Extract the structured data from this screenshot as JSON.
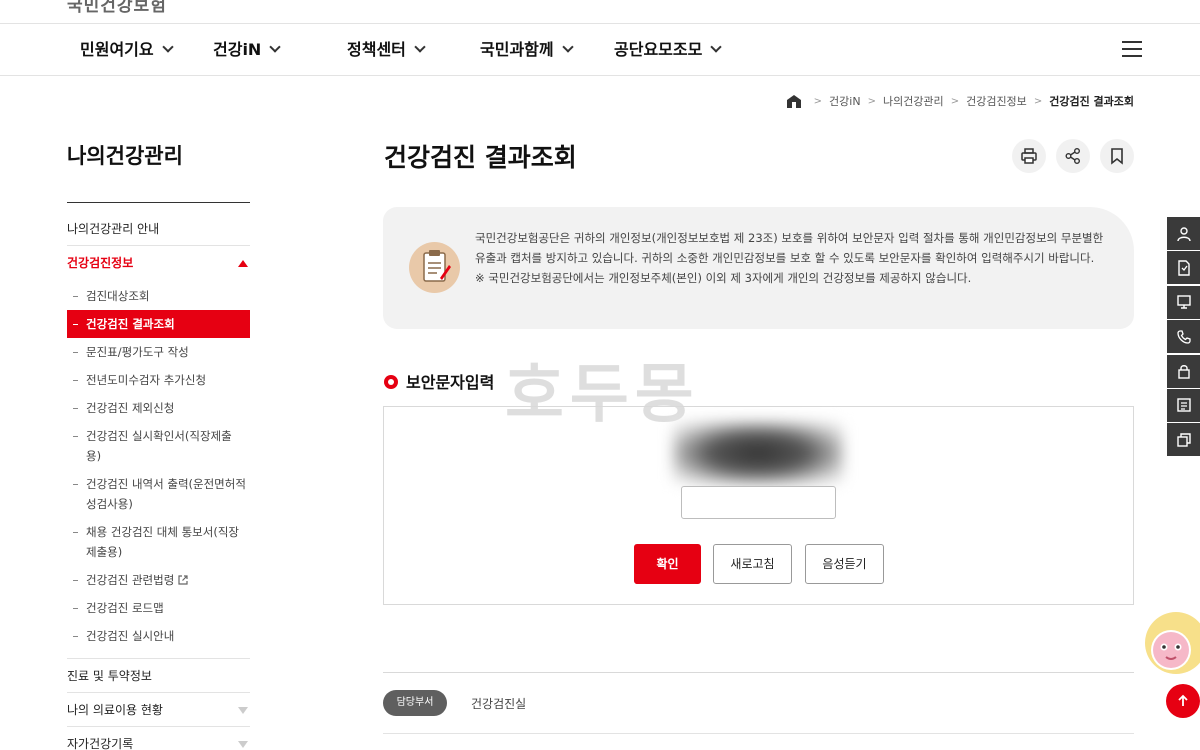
{
  "header": {
    "logo_text": "국민건강보험",
    "gnb": [
      {
        "label": "민원여기요"
      },
      {
        "label": "건강iN"
      },
      {
        "label": "정책센터"
      },
      {
        "label": "국민과함께"
      },
      {
        "label": "공단요모조모"
      }
    ]
  },
  "breadcrumb": {
    "items": [
      "건강iN",
      "나의건강관리",
      "건강검진정보"
    ],
    "current": "건강검진 결과조회"
  },
  "sidebar": {
    "title": "나의건강관리",
    "items": [
      {
        "label": "나의건강관리 안내"
      },
      {
        "label": "건강검진정보"
      },
      {
        "label": "진료 및 투약정보"
      },
      {
        "label": "나의 의료이용 현황"
      },
      {
        "label": "자가건강기록"
      }
    ],
    "subitems": [
      {
        "label": "검진대상조회"
      },
      {
        "label": "건강검진 결과조회"
      },
      {
        "label": "문진표/평가도구 작성"
      },
      {
        "label": "전년도미수검자 추가신청"
      },
      {
        "label": "건강검진 제외신청"
      },
      {
        "label": "건강검진 실시확인서(직장제출용)"
      },
      {
        "label": "건강검진 내역서 출력(운전면허적성검사용)"
      },
      {
        "label": "채용 건강검진 대체 통보서(직장제출용)"
      },
      {
        "label": "건강검진 관련법령"
      },
      {
        "label": "건강검진 로드맵"
      },
      {
        "label": "건강검진 실시안내"
      }
    ]
  },
  "main": {
    "title": "건강검진 결과조회",
    "notice": {
      "line1": "국민건강보험공단은 귀하의 개인정보(개인정보보호법 제 23조) 보호를 위하여 보안문자 입력 절차를 통해 개인민감정보의 무분별한 유출과 캡처를 방지하고 있습니다. 귀하의 소중한 개인민감정보를 보호 할 수 있도록 보안문자를 확인하여 입력해주시기 바랍니다.",
      "line2": "※ 국민건강보험공단에서는 개인정보주체(본인) 이외 제 3자에게 개인의 건강정보를 제공하지 않습니다."
    },
    "security_section_title": "보안문자입력",
    "watermark": "호두몽",
    "buttons": {
      "confirm": "확인",
      "refresh": "새로고침",
      "audio": "음성듣기"
    },
    "dept": {
      "badge": "담당부서",
      "name": "건강검진실"
    }
  },
  "colors": {
    "accent": "#e60012",
    "notice_bg": "#f2f2f2",
    "quick_menu_bg": "#3a3a3a"
  }
}
